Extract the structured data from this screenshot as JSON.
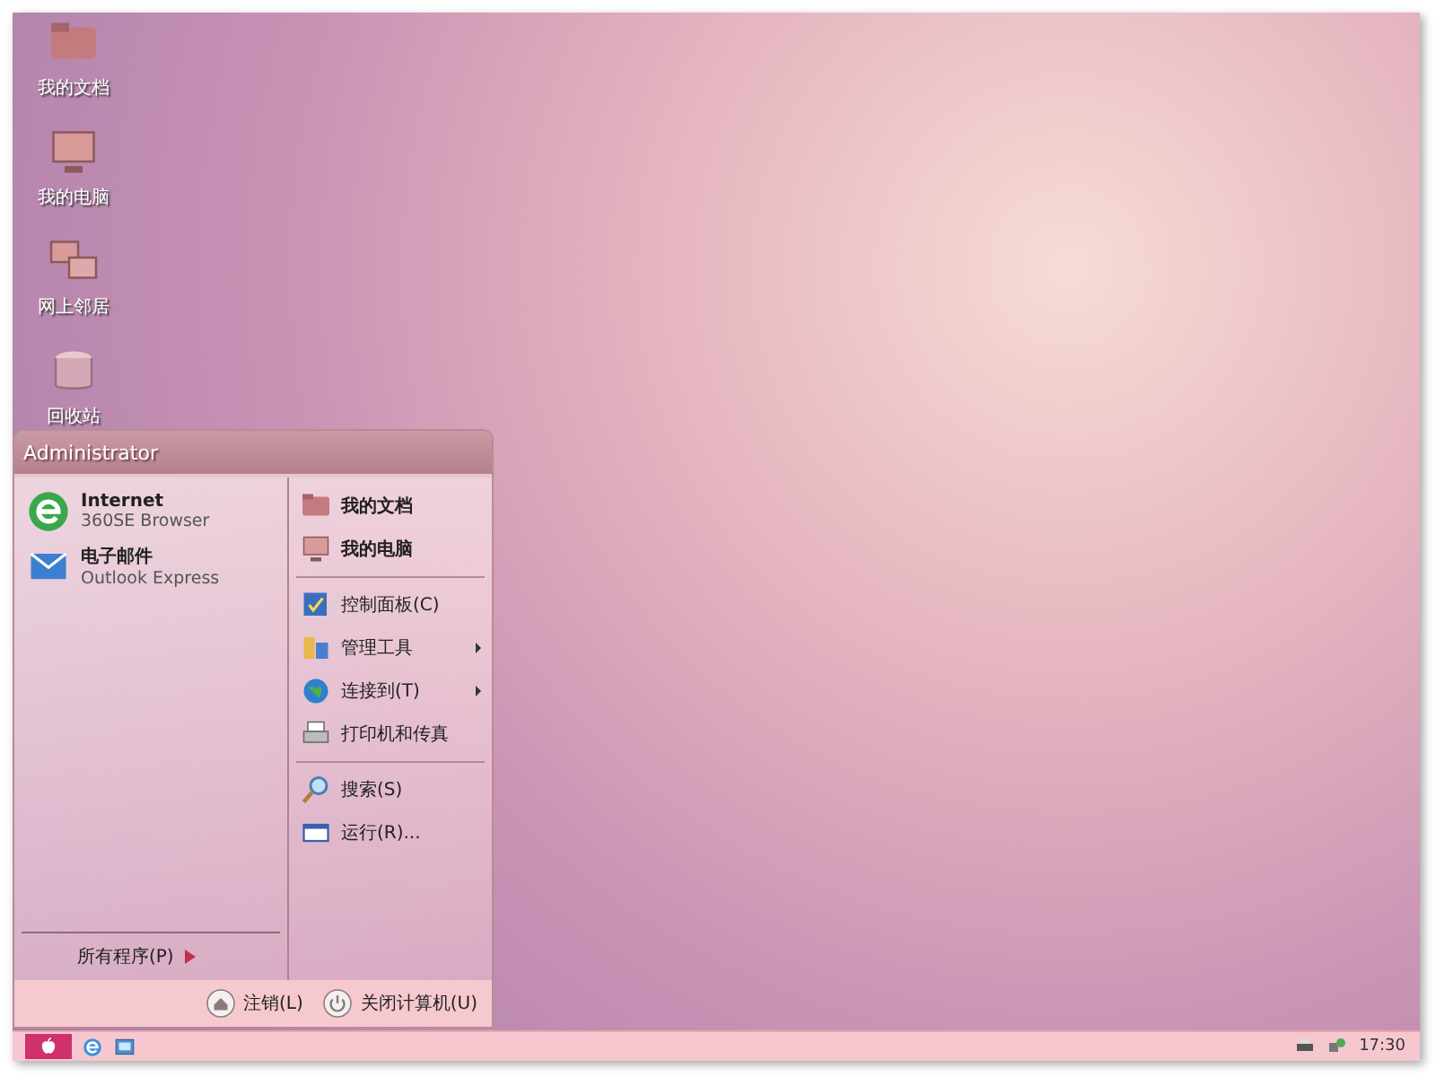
{
  "desktop_icons": [
    {
      "label": "我的文档",
      "kind": "folder"
    },
    {
      "label": "我的电脑",
      "kind": "computer"
    },
    {
      "label": "网上邻居",
      "kind": "network"
    },
    {
      "label": "回收站",
      "kind": "bin"
    }
  ],
  "start_menu": {
    "user": "Administrator",
    "pinned": [
      {
        "title": "Internet",
        "subtitle": "360SE Browser",
        "kind": "browser"
      },
      {
        "title": "电子邮件",
        "subtitle": "Outlook Express",
        "kind": "mail"
      }
    ],
    "all_programs": "所有程序(P)",
    "places": [
      {
        "kind": "place",
        "label": "我的文档",
        "submenu": false
      },
      {
        "kind": "place",
        "label": "我的电脑",
        "submenu": false
      },
      {
        "kind": "separator"
      },
      {
        "kind": "item",
        "label": "控制面板(C)",
        "submenu": false
      },
      {
        "kind": "item",
        "label": "管理工具",
        "submenu": true
      },
      {
        "kind": "item",
        "label": "连接到(T)",
        "submenu": true
      },
      {
        "kind": "item",
        "label": "打印机和传真",
        "submenu": false
      },
      {
        "kind": "separator"
      },
      {
        "kind": "item",
        "label": "搜索(S)",
        "submenu": false
      },
      {
        "kind": "item",
        "label": "运行(R)...",
        "submenu": false
      }
    ],
    "footer_buttons": [
      {
        "label": "注销(L)",
        "kind": "logoff"
      },
      {
        "label": "关闭计算机(U)",
        "kind": "power"
      }
    ]
  },
  "taskbar": {
    "clock": "17:30"
  }
}
